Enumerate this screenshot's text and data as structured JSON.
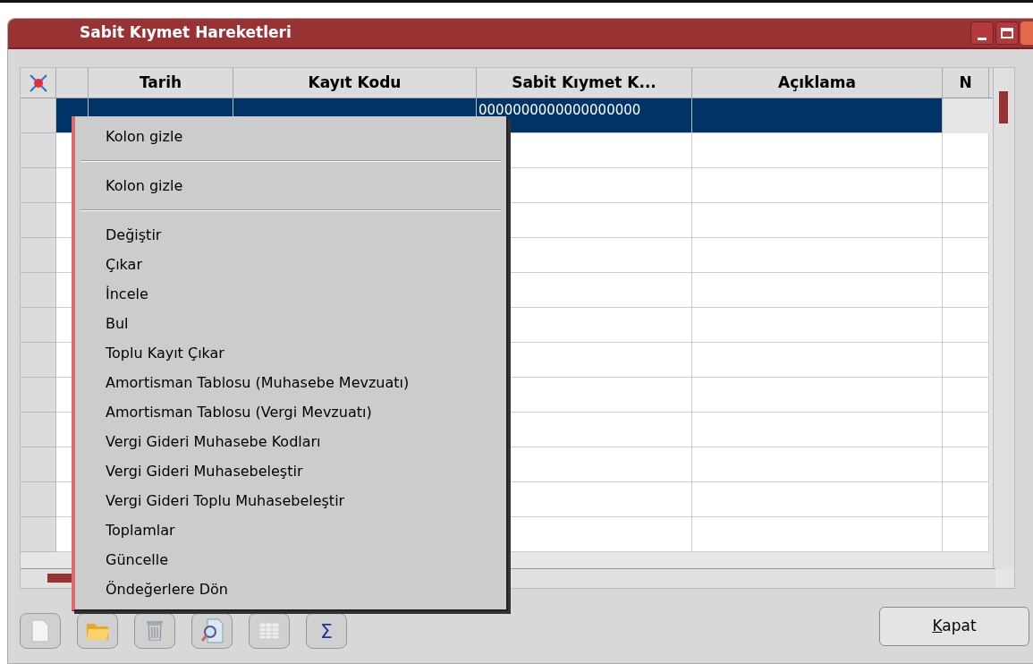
{
  "window": {
    "title": "Sabit Kıymet Hareketleri"
  },
  "table": {
    "columns": [
      "Tarih",
      "Kayıt Kodu",
      "Sabit Kıymet K...",
      "Açıklama",
      "N"
    ],
    "rows": [
      {
        "selected": true,
        "cells": [
          "",
          "",
          "0000000000000000000",
          ""
        ]
      }
    ]
  },
  "context_menu": {
    "items": [
      {
        "kind": "item",
        "label": "Kolon gizle"
      },
      {
        "kind": "separator"
      },
      {
        "kind": "item",
        "label": "Kolon gizle"
      },
      {
        "kind": "separator"
      },
      {
        "kind": "item",
        "label": "Değiştir"
      },
      {
        "kind": "item",
        "label": "Çıkar"
      },
      {
        "kind": "item",
        "label": "İncele"
      },
      {
        "kind": "item",
        "label": "Bul"
      },
      {
        "kind": "item",
        "label": "Toplu Kayıt Çıkar"
      },
      {
        "kind": "item",
        "label": "Amortisman Tablosu (Muhasebe Mevzuatı)"
      },
      {
        "kind": "item",
        "label": "Amortisman Tablosu (Vergi Mevzuatı)"
      },
      {
        "kind": "item",
        "label": "Vergi Gideri Muhasebe Kodları"
      },
      {
        "kind": "item",
        "label": "Vergi Gideri Muhasebeleştir"
      },
      {
        "kind": "item",
        "label": "Vergi Gideri Toplu Muhasebeleştir"
      },
      {
        "kind": "item",
        "label": "Toplamlar"
      },
      {
        "kind": "item",
        "label": "Güncelle"
      },
      {
        "kind": "item",
        "label": "Öndeğerlere Dön"
      }
    ]
  },
  "toolbar": [
    {
      "kind": "new"
    },
    {
      "kind": "open"
    },
    {
      "kind": "delete"
    },
    {
      "kind": "inspect"
    },
    {
      "kind": "grid"
    },
    {
      "kind": "sum",
      "label": "Σ"
    }
  ],
  "buttons": [
    {
      "label": "Kapat"
    }
  ]
}
